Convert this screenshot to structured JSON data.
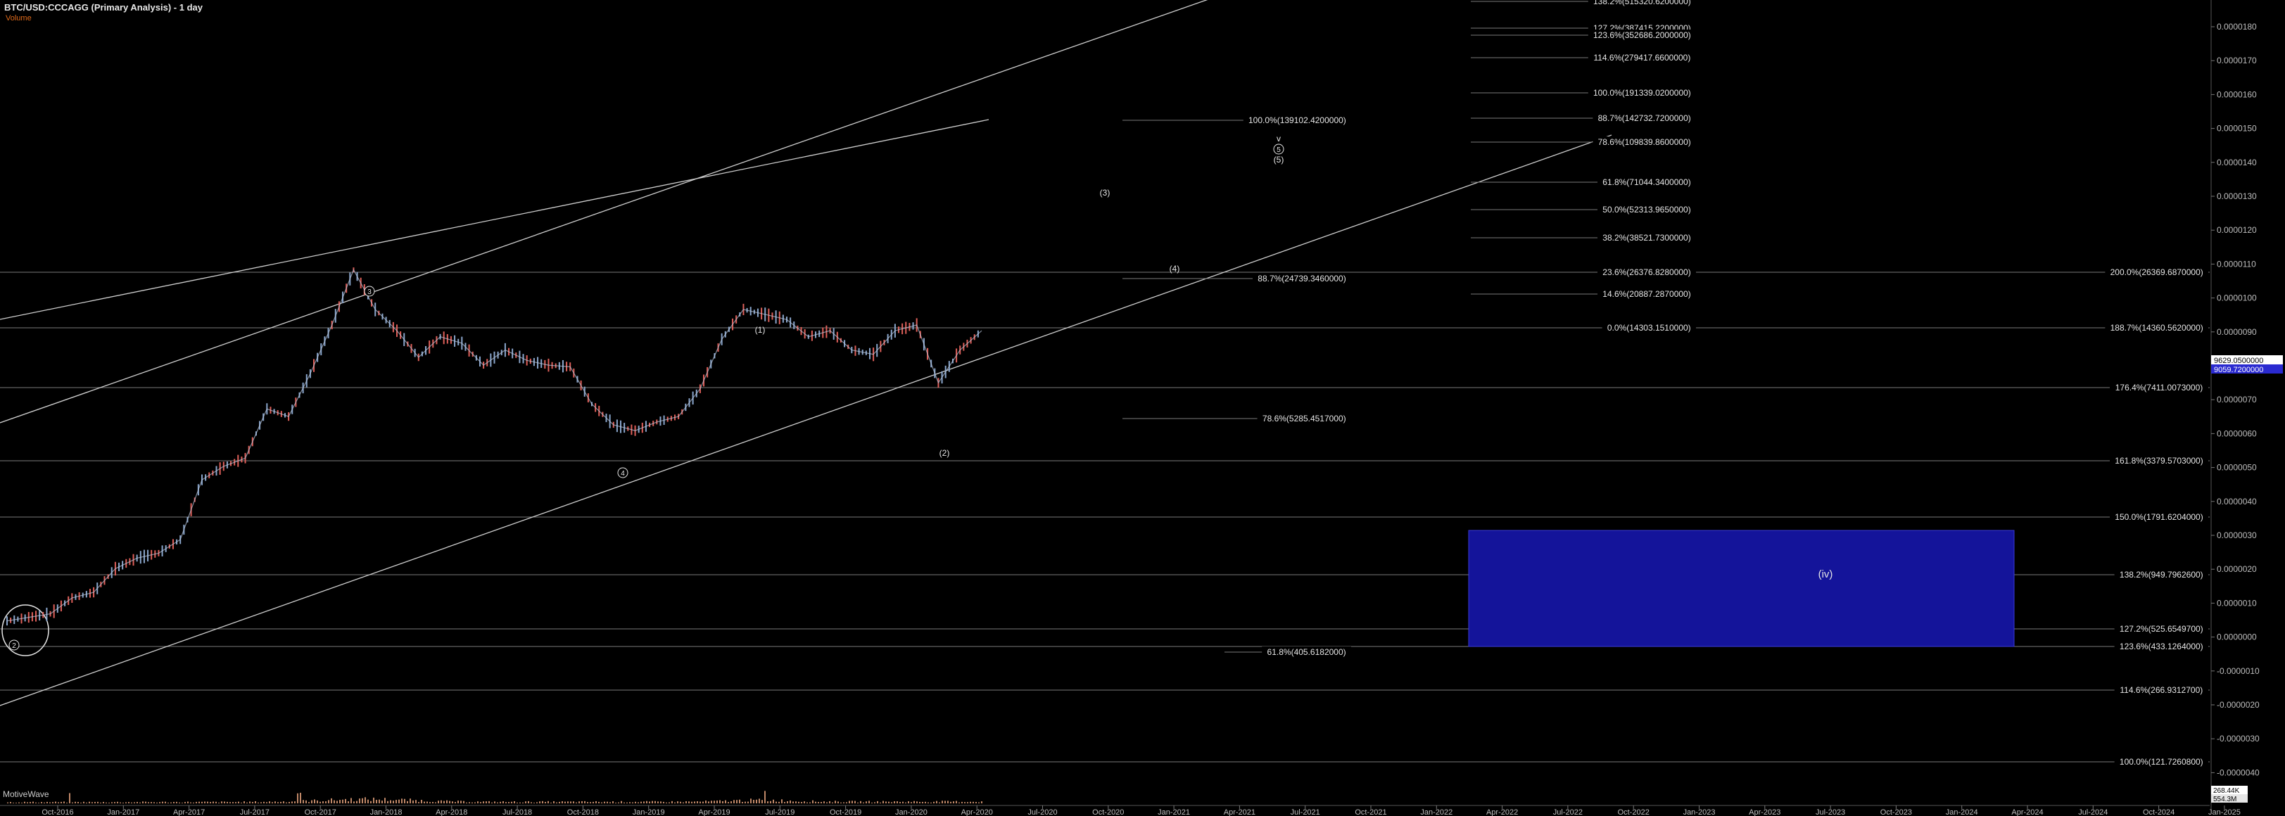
{
  "header": {
    "title": "BTC/USD:CCCAGG (Primary Analysis) - 1 day",
    "subtitle": "Volume"
  },
  "footer": {
    "label": "MotiveWave"
  },
  "colors": {
    "background": "#000000",
    "grid_line": "#7a7a7a",
    "candle_up": "#8aa6cc",
    "candle_down": "#e0605a",
    "zone_fill": "#14149a",
    "volume": "#e2a07a",
    "price_tag_1": "#ffffff",
    "price_tag_2": "#2a2ad0",
    "axis_text": "#bdbdbd"
  },
  "chart_data": {
    "type": "line",
    "title": "BTC/USD:CCCAGG (Primary Analysis) - 1 day",
    "y_scale": "log",
    "ylim_display": [
      0,
      0.00018
    ],
    "y_ticks": [
      "0.0000180",
      "0.0000170",
      "0.0000160",
      "0.0000150",
      "0.0000140",
      "0.0000130",
      "0.0000120",
      "0.0000110",
      "0.0000100",
      "0.0000090",
      "0.0000080",
      "0.0000070",
      "0.0000060",
      "0.0000050",
      "0.0000040",
      "0.0000030",
      "0.0000020",
      "0.0000010",
      "0.0000000",
      "-0.0000010",
      "-0.0000020",
      "-0.0000030",
      "-0.0000040"
    ],
    "x_ticks": [
      "Oct-2016",
      "Jan-2017",
      "Apr-2017",
      "Jul-2017",
      "Oct-2017",
      "Jan-2018",
      "Apr-2018",
      "Jul-2018",
      "Oct-2018",
      "Jan-2019",
      "Apr-2019",
      "Jul-2019",
      "Oct-2019",
      "Jan-2020",
      "Apr-2020",
      "Jul-2020",
      "Oct-2020",
      "Jan-2021",
      "Apr-2021",
      "Jul-2021",
      "Oct-2021",
      "Jan-2022",
      "Apr-2022",
      "Jul-2022",
      "Oct-2022",
      "Jan-2023",
      "Apr-2023",
      "Jul-2023",
      "Oct-2023",
      "Jan-2024",
      "Apr-2024",
      "Jul-2024",
      "Oct-2024",
      "Jan-2025"
    ],
    "price_series": {
      "name": "",
      "x": [
        "Aug-2016",
        "Sep-2016",
        "Oct-2016",
        "Nov-2016",
        "Dec-2016",
        "Jan-2017",
        "Feb-2017",
        "Mar-2017",
        "Apr-2017",
        "May-2017",
        "Jun-2017",
        "Jul-2017",
        "Aug-2017",
        "Sep-2017",
        "Oct-2017",
        "Nov-2017",
        "Dec-2017",
        "Jan-2018",
        "Feb-2018",
        "Mar-2018",
        "Apr-2018",
        "May-2018",
        "Jun-2018",
        "Jul-2018",
        "Aug-2018",
        "Sep-2018",
        "Oct-2018",
        "Nov-2018",
        "Dec-2018",
        "Jan-2019",
        "Feb-2019",
        "Mar-2019",
        "Apr-2019",
        "May-2019",
        "Jun-2019",
        "Jul-2019",
        "Aug-2019",
        "Sep-2019",
        "Oct-2019",
        "Nov-2019",
        "Dec-2019",
        "Jan-2020",
        "Feb-2020",
        "Mar-2020",
        "Apr-2020",
        "May-2020"
      ],
      "y": [
        580,
        600,
        620,
        720,
        760,
        950,
        1050,
        1100,
        1250,
        2200,
        2500,
        2700,
        4300,
        4000,
        6000,
        9500,
        16000,
        11000,
        9000,
        7000,
        8500,
        8000,
        6500,
        7500,
        6800,
        6500,
        6400,
        4500,
        3700,
        3500,
        3800,
        4000,
        5200,
        8300,
        11000,
        10500,
        10000,
        8500,
        9000,
        7500,
        7200,
        9000,
        9500,
        5500,
        7500,
        9000
      ]
    },
    "horizontal_levels": [
      {
        "label": "200.0%(26369.6870000)"
      },
      {
        "label": "188.7%(14360.5620000)"
      },
      {
        "label": "176.4%(7411.0073000)"
      },
      {
        "label": "161.8%(3379.5703000)"
      },
      {
        "label": "150.0%(1791.6204000)"
      },
      {
        "label": "138.2%(949.7962600)"
      },
      {
        "label": "127.2%(525.6549700)"
      },
      {
        "label": "123.6%(433.1264000)"
      },
      {
        "label": "114.6%(266.9312700)"
      },
      {
        "label": "100.0%(121.7260800)"
      }
    ],
    "fib_upper": [
      {
        "label": "138.2%(515320.6200000)"
      },
      {
        "label": "127.2%(387415.2200000)"
      },
      {
        "label": "123.6%(352686.2000000)"
      },
      {
        "label": "114.6%(279417.6600000)"
      },
      {
        "label": "100.0%(191339.0200000)"
      },
      {
        "label": "88.7%(142732.7200000)"
      },
      {
        "label": "78.6%(109839.8600000)"
      },
      {
        "label": "61.8%(71044.3400000)"
      },
      {
        "label": "50.0%(52313.9650000)"
      },
      {
        "label": "38.2%(38521.7300000)"
      },
      {
        "label": "23.6%(26376.8280000)"
      },
      {
        "label": "14.6%(20887.2870000)"
      },
      {
        "label": "0.0%(14303.1510000)"
      }
    ],
    "fib_mid": [
      {
        "label": "100.0%(139102.4200000)"
      },
      {
        "label": "88.7%(24739.3460000)"
      },
      {
        "label": "78.6%(5285.4517000)"
      },
      {
        "label": "61.8%(405.6182000)"
      }
    ],
    "wave_labels": [
      "2",
      "3",
      "4",
      "(1)",
      "(2)",
      "(3)",
      "(4)",
      "v",
      "5",
      "(5)",
      "(iv)"
    ],
    "price_tags": [
      "9629.0500000",
      "9059.7200000"
    ],
    "volume_tags": [
      "268.44K",
      "554.3M"
    ]
  }
}
